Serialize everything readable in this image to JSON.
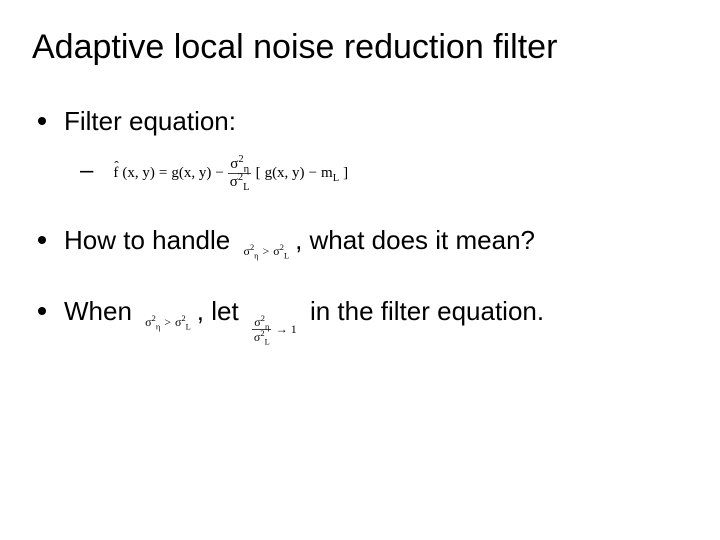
{
  "title": "Adaptive local noise reduction filter",
  "bullets": {
    "b1": "Filter equation:",
    "b2_pre": "How to handle",
    "b2_post": ", what does it mean?",
    "b3_pre": "When",
    "b3_mid": ", let",
    "b3_post": "in the filter equation."
  },
  "math": {
    "eq_fhat": "f",
    "eq_args": "(x, y)",
    "eq_eq": "=",
    "eq_g": "g(x, y)",
    "eq_minus": "−",
    "eq_sigma_eta": "σ",
    "eq_sigma_eta_sub": "η",
    "eq_sigma_L": "σ",
    "eq_sigma_L_sub": "L",
    "eq_sq": "2",
    "eq_bracket_open": "[",
    "eq_bracket_close": "]",
    "eq_mL": "m",
    "eq_mL_sub": "L",
    "ineq_gt": ">",
    "ratio_arrow": "→ 1"
  }
}
